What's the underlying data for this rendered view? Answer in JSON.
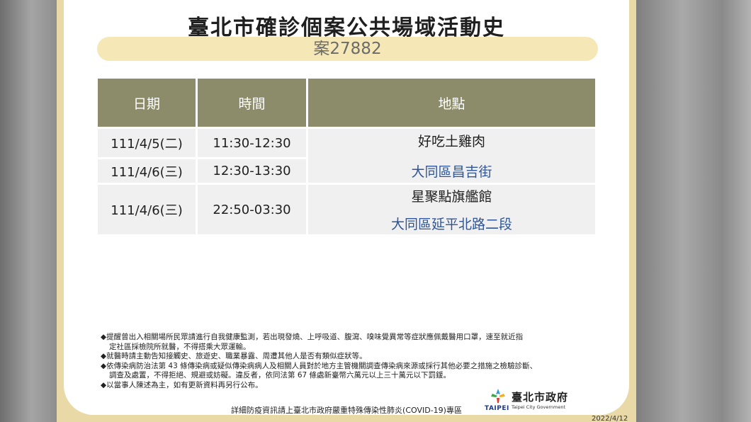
{
  "title": "臺北市確診個案公共場域活動史",
  "case_label": "案27882",
  "table": {
    "headers": {
      "date": "日期",
      "time": "時間",
      "location": "地點"
    },
    "rows": [
      {
        "date": "111/4/5(二)",
        "time": "11:30-12:30"
      },
      {
        "date": "111/4/6(三)",
        "time": "12:30-13:30"
      },
      {
        "date": "111/4/6(三)",
        "time": "22:50-03:30"
      }
    ],
    "places": [
      {
        "name": "好吃土雞肉",
        "address": "大同區昌吉街"
      },
      {
        "name": "星聚點旗艦館",
        "address": "大同區延平北路二段"
      }
    ]
  },
  "notes": [
    "◆提醒曾出入相關場所民眾請進行自我健康監測，若出現發燒、上呼吸道、腹瀉、嗅味覺異常等症狀應佩戴醫用口罩，速至就近指",
    "定社區採檢院所就醫，不得搭乘大眾運輸。",
    "◆就醫時請主動告知接觸史、旅遊史、職業暴露、周遭其他人是否有類似症狀等。",
    "◆依傳染病防治法第 43 條傳染病或疑似傳染病病人及相關人員對於地方主管機關調查傳染病來源或採行其他必要之措施之檢驗診斷、",
    "調查及處置，不得拒絕、規避或妨礙。違反者，依同法第 67 條處新臺幣六萬元以上三十萬元以下罰鍰。",
    "◆以當事人陳述為主，如有更新資料再另行公布。"
  ],
  "footer": "詳細防疫資訊請上臺北市政府嚴重特殊傳染性肺炎(COVID-19)專區",
  "logo": {
    "zh": "臺北市政府",
    "en": "TAIPEI",
    "sub": "Taipei City Government",
    "icon": "taipei-logo-icon"
  },
  "date_stamp": "2022/4/12",
  "colors": {
    "frame": "#e9d9a6",
    "pill": "#f6e7b6",
    "header": "#8c8c6b",
    "cell": "#f0f0f0",
    "address": "#2f5597"
  }
}
